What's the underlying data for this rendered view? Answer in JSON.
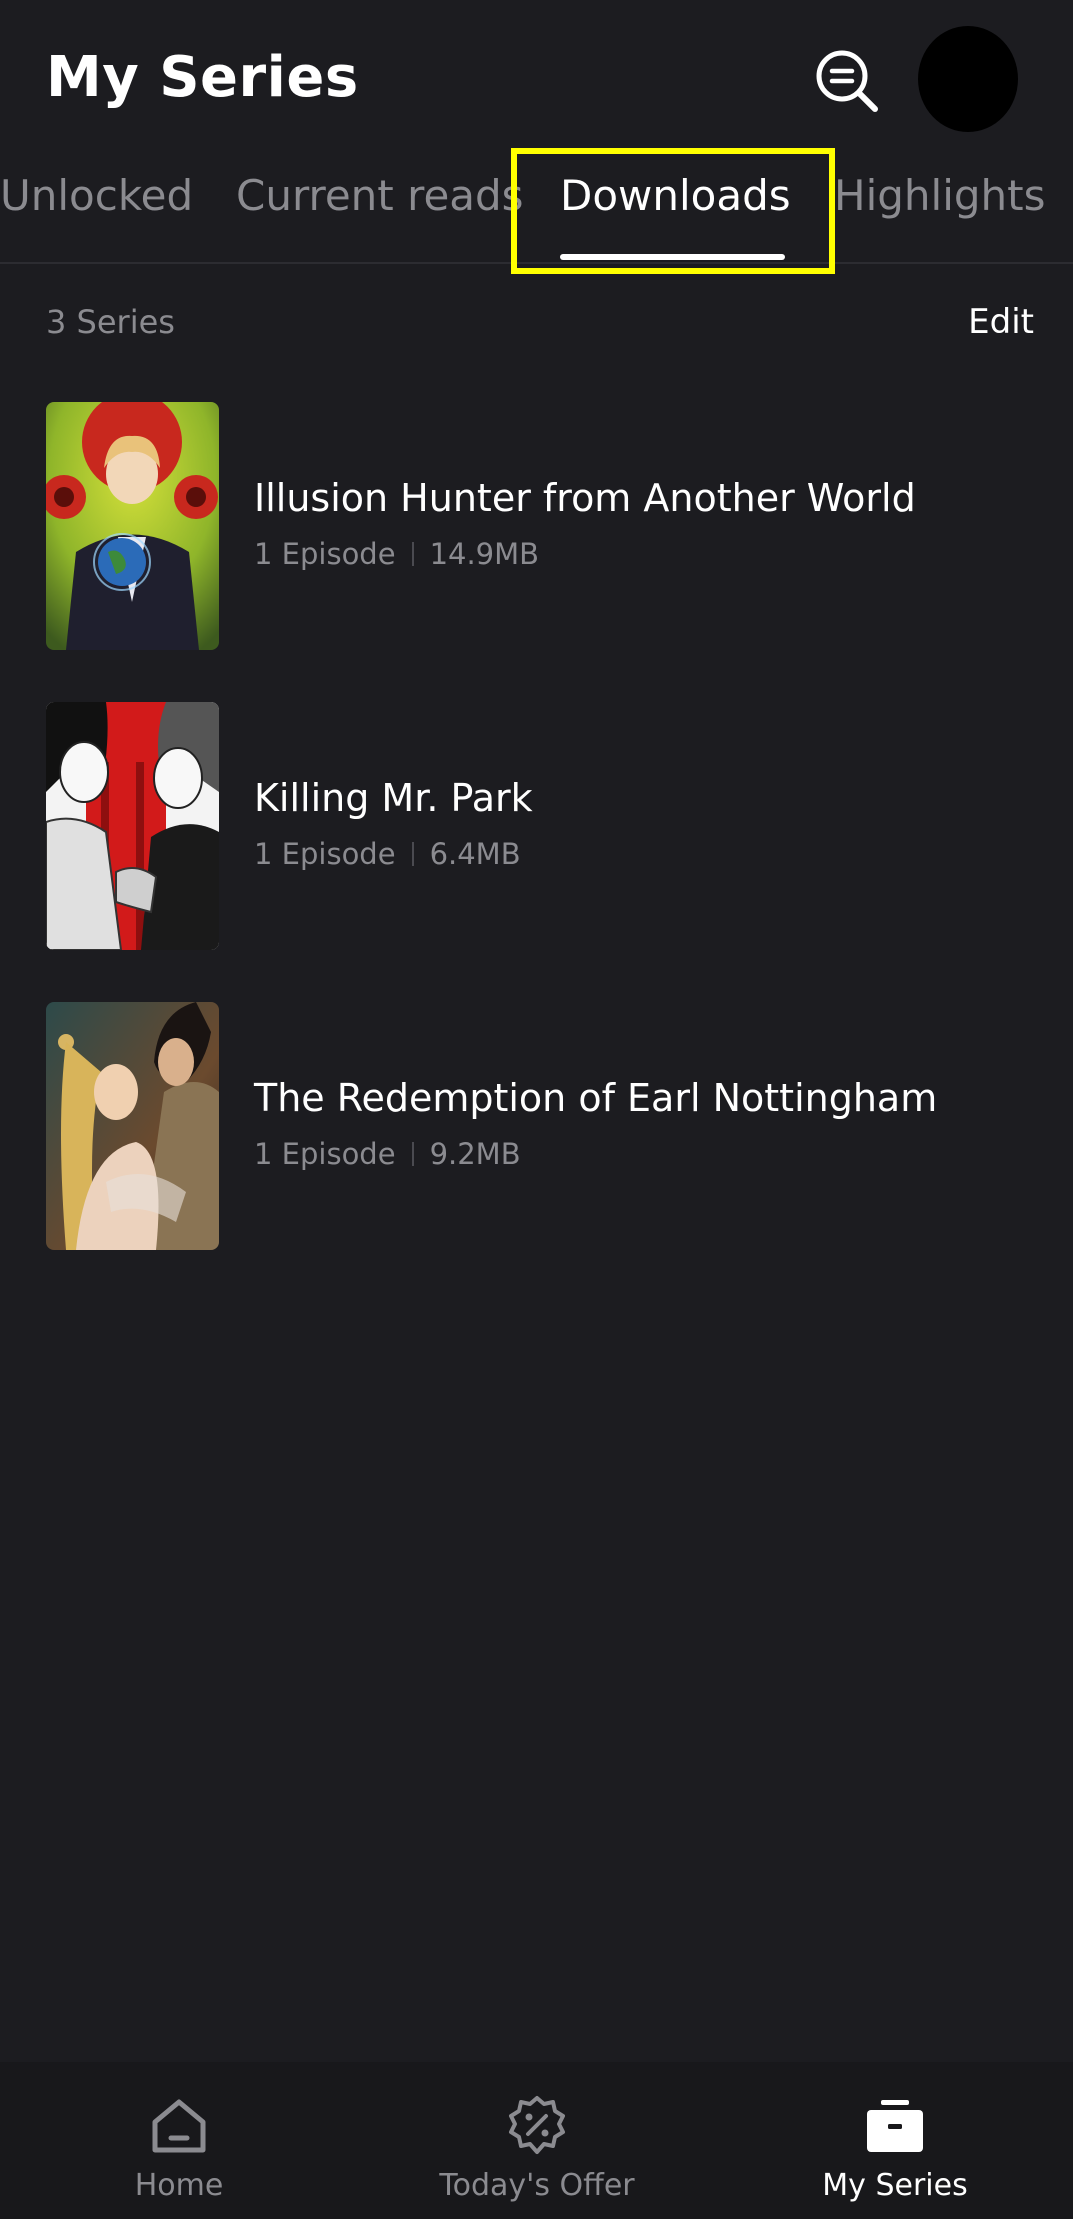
{
  "header": {
    "title": "My Series"
  },
  "tabs": [
    {
      "label": "Unlocked",
      "active": false
    },
    {
      "label": "Current reads",
      "active": false
    },
    {
      "label": "Downloads",
      "active": true
    },
    {
      "label": "Highlights",
      "active": false
    }
  ],
  "list": {
    "count_label": "3 Series",
    "edit_label": "Edit"
  },
  "series": [
    {
      "title": "Illusion Hunter from Another World",
      "episodes": "1 Episode",
      "size": "14.9MB"
    },
    {
      "title": "Killing Mr. Park",
      "episodes": "1 Episode",
      "size": "6.4MB"
    },
    {
      "title": "The Redemption of Earl Nottingham",
      "episodes": "1 Episode",
      "size": "9.2MB"
    }
  ],
  "bottom_nav": [
    {
      "label": "Home",
      "icon": "home-icon",
      "active": false
    },
    {
      "label": "Today's Offer",
      "icon": "discount-badge-icon",
      "active": false
    },
    {
      "label": "My Series",
      "icon": "library-box-icon",
      "active": true
    }
  ],
  "colors": {
    "background": "#1c1c20",
    "nav_background": "#18181b",
    "text_primary": "#ffffff",
    "text_secondary": "#8b8b90",
    "highlight_box": "#ffff00"
  }
}
